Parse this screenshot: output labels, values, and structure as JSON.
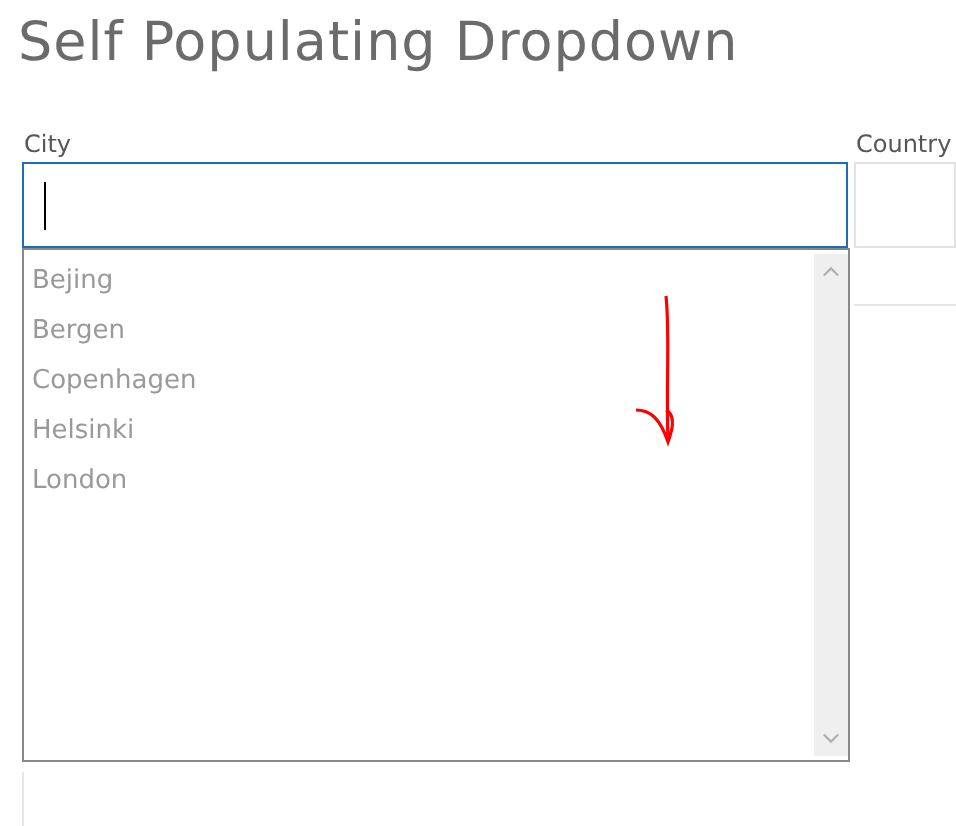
{
  "title": "Self Populating Dropdown",
  "fields": [
    {
      "label": "City",
      "focused": true,
      "options": [
        "Bejing",
        "Bergen",
        "Copenhagen",
        "Helsinki",
        "London"
      ]
    },
    {
      "label": "Country",
      "focused": false
    }
  ]
}
